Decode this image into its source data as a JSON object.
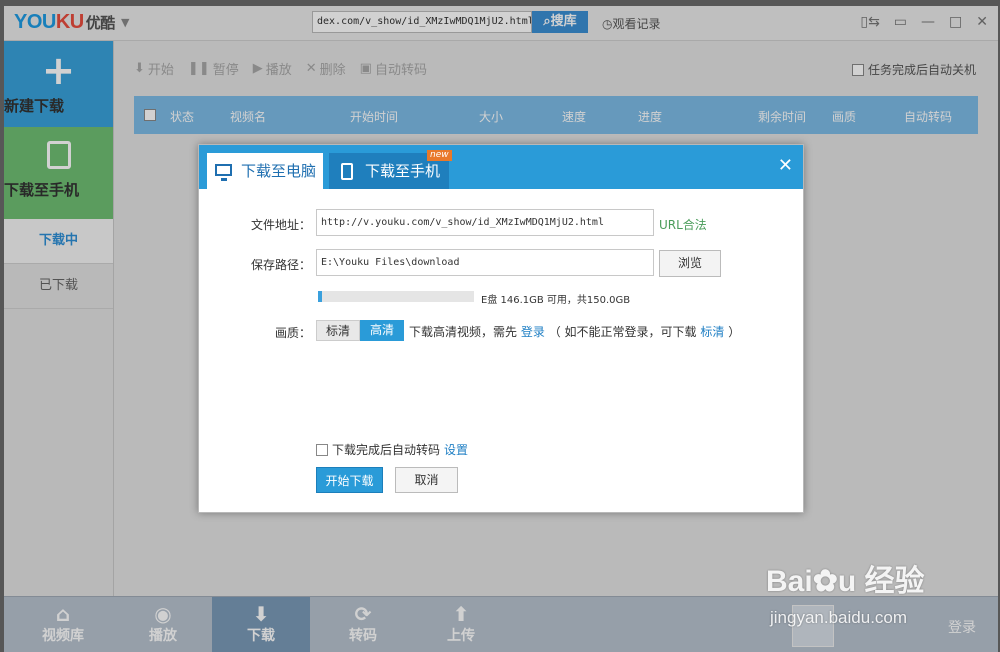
{
  "titlebar": {
    "logo_part1": "YOU",
    "logo_part2": "KU",
    "logo_cn": "优酷",
    "url_value": "dex.com/v_show/id_XMzIwMDQ1MjU2.html",
    "search_label": "搜库",
    "history_label": "观看记录"
  },
  "sidebar": {
    "new_download": "新建下载",
    "download_to_phone": "下载至手机",
    "downloading": "下载中",
    "downloaded": "已下载"
  },
  "toolbar": {
    "start": "开始",
    "pause": "暂停",
    "play": "播放",
    "delete": "删除",
    "auto_convert": "自动转码",
    "shutdown_after": "任务完成后自动关机"
  },
  "table": {
    "columns": [
      "状态",
      "视频名",
      "开始时间",
      "大小",
      "速度",
      "进度",
      "剩余时间",
      "画质",
      "自动转码"
    ]
  },
  "bottom_nav": {
    "items": [
      "视频库",
      "播放",
      "下载",
      "转码",
      "上传"
    ],
    "active": "下载",
    "login": "登录"
  },
  "dialog": {
    "tab_pc": "下载至电脑",
    "tab_phone": "下载至手机",
    "new_badge": "new",
    "url_label": "文件地址：",
    "url_value": "http://v.youku.com/v_show/id_XMzIwMDQ1MjU2.html",
    "url_status": "URL合法",
    "path_label": "保存路径：",
    "path_value": "E:\\Youku Files\\download",
    "browse_label": "浏览",
    "disk_info": "E盘 146.1GB 可用，共150.0GB",
    "disk_used_fraction": 0.026,
    "quality_label": "画质：",
    "quality_standard": "标清",
    "quality_hd": "高清",
    "quality_selected": "高清",
    "note_prefix": "下载高清视频，需先",
    "note_login": "登录",
    "note_middle": "（ 如不能正常登录，可下载",
    "note_standard": "标清",
    "note_suffix": "）",
    "auto_convert_label": "下载完成后自动转码",
    "settings_link": "设置",
    "start_button": "开始下载",
    "cancel_button": "取消"
  },
  "watermark": {
    "brand": "Baiдu 经验",
    "url": "jingyan.baidu.com"
  }
}
